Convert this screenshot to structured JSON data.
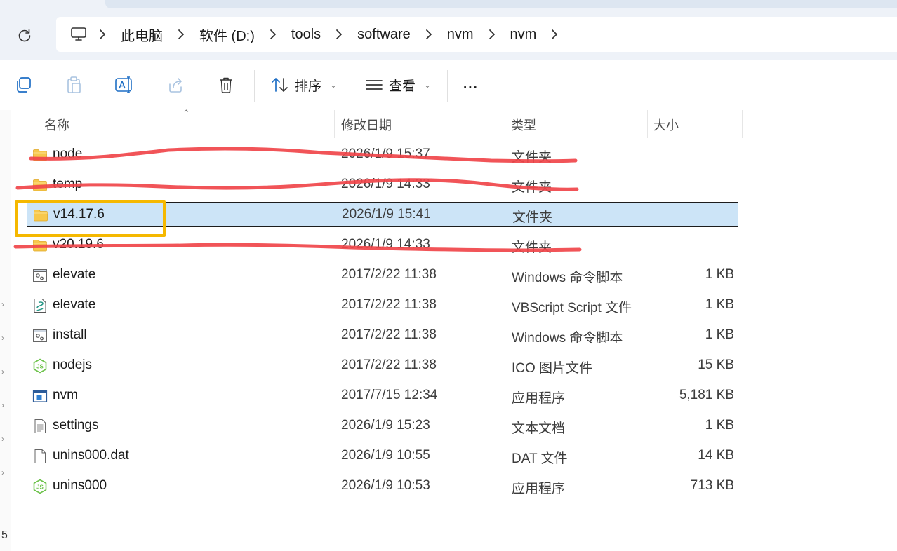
{
  "address_bar": {
    "crumbs": [
      "此电脑",
      "软件 (D:)",
      "tools",
      "software",
      "nvm",
      "nvm"
    ]
  },
  "toolbar": {
    "sort_label": "排序",
    "view_label": "查看",
    "more_label": "..."
  },
  "columns": {
    "name": "名称",
    "date": "修改日期",
    "type": "类型",
    "size": "大小"
  },
  "files": [
    {
      "name": "node",
      "date": "2026/1/9 15:37",
      "type": "文件夹",
      "size": "",
      "icon": "folder-icon",
      "redacted": true
    },
    {
      "name": "temp",
      "date": "2026/1/9 14:33",
      "type": "文件夹",
      "size": "",
      "icon": "folder-icon",
      "redacted": true
    },
    {
      "name": "v14.17.6",
      "date": "2026/1/9 15:41",
      "type": "文件夹",
      "size": "",
      "icon": "folder-icon",
      "selected": true
    },
    {
      "name": "v20.19.6",
      "date": "2026/1/9 14:33",
      "type": "文件夹",
      "size": "",
      "icon": "folder-icon",
      "redacted": true
    },
    {
      "name": "elevate",
      "date": "2017/2/22 11:38",
      "type": "Windows 命令脚本",
      "size": "1 KB",
      "icon": "script-gear-icon"
    },
    {
      "name": "elevate",
      "date": "2017/2/22 11:38",
      "type": "VBScript Script 文件",
      "size": "1 KB",
      "icon": "vbscript-icon"
    },
    {
      "name": "install",
      "date": "2017/2/22 11:38",
      "type": "Windows 命令脚本",
      "size": "1 KB",
      "icon": "script-gear-icon"
    },
    {
      "name": "nodejs",
      "date": "2017/2/22 11:38",
      "type": "ICO 图片文件",
      "size": "15 KB",
      "icon": "nodejs-icon"
    },
    {
      "name": "nvm",
      "date": "2017/7/15 12:34",
      "type": "应用程序",
      "size": "5,181 KB",
      "icon": "app-window-icon"
    },
    {
      "name": "settings",
      "date": "2026/1/9 15:23",
      "type": "文本文档",
      "size": "1 KB",
      "icon": "text-doc-icon"
    },
    {
      "name": "unins000.dat",
      "date": "2026/1/9 10:55",
      "type": "DAT 文件",
      "size": "14 KB",
      "icon": "blank-file-icon"
    },
    {
      "name": "unins000",
      "date": "2026/1/9 10:53",
      "type": "应用程序",
      "size": "713 KB",
      "icon": "nodejs-icon"
    }
  ],
  "left_nav": {
    "bottom_text": "5"
  },
  "colors": {
    "selection": "#cce4f7",
    "highlight_box": "#f5b800",
    "redaction_stroke": "#f0454a",
    "folder": "#f7c84c"
  }
}
